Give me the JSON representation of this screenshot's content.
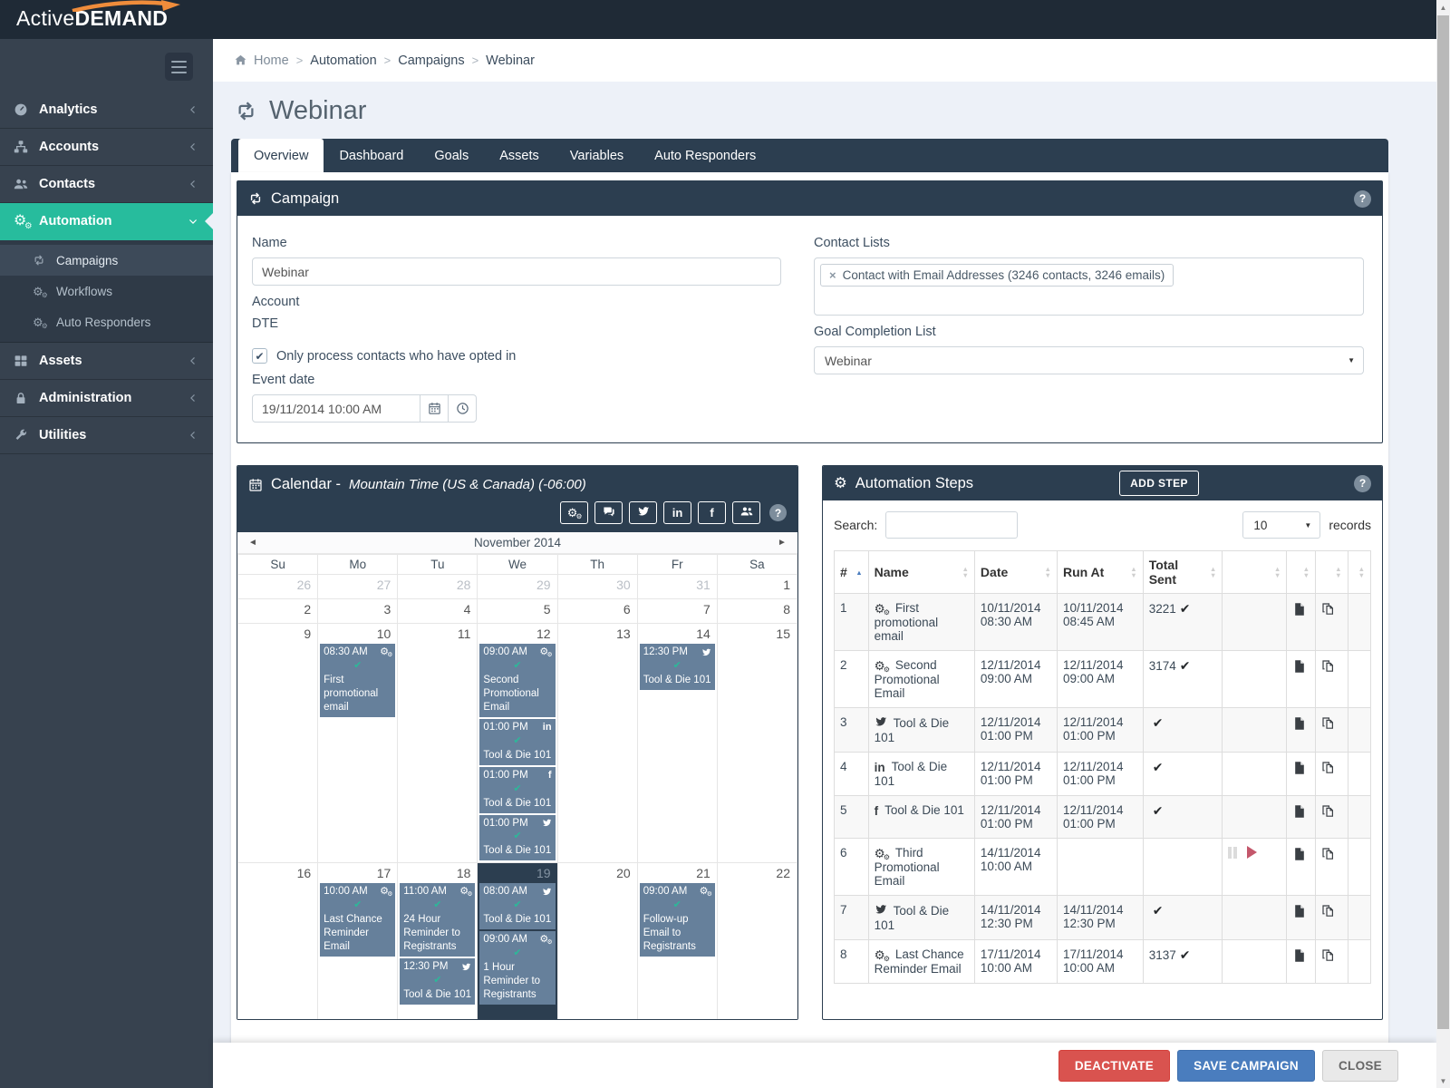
{
  "navbar": {
    "logo_active": "Active",
    "logo_demand": "DEMAND"
  },
  "colors": {
    "accent_green": "#27bc9d",
    "navy": "#2c3e50",
    "event_slate": "#66809b",
    "check_teal": "#2cb899",
    "danger": "#d9534f",
    "primary": "#4a7dbe"
  },
  "sidebar": {
    "items": [
      {
        "label": "Analytics",
        "icon": "gauge",
        "chevron": "left"
      },
      {
        "label": "Accounts",
        "icon": "sitemap",
        "chevron": "left"
      },
      {
        "label": "Contacts",
        "icon": "users",
        "chevron": "left"
      },
      {
        "label": "Automation",
        "icon": "gears",
        "chevron": "down",
        "active": true,
        "submenu": [
          {
            "label": "Campaigns",
            "icon": "retweet",
            "active": true
          },
          {
            "label": "Workflows",
            "icon": "gears"
          },
          {
            "label": "Auto Responders",
            "icon": "gears"
          }
        ]
      },
      {
        "label": "Assets",
        "icon": "grid",
        "chevron": "left"
      },
      {
        "label": "Administration",
        "icon": "lock",
        "chevron": "left"
      },
      {
        "label": "Utilities",
        "icon": "wrench",
        "chevron": "left"
      }
    ]
  },
  "breadcrumb": {
    "items": [
      "Home",
      "Automation",
      "Campaigns",
      "Webinar"
    ]
  },
  "page": {
    "title": "Webinar"
  },
  "tabs": [
    {
      "label": "Overview",
      "active": true
    },
    {
      "label": "Dashboard"
    },
    {
      "label": "Goals"
    },
    {
      "label": "Assets"
    },
    {
      "label": "Variables"
    },
    {
      "label": "Auto Responders"
    }
  ],
  "campaign": {
    "panel_title": "Campaign",
    "name_label": "Name",
    "name_value": "Webinar",
    "account_label": "Account",
    "account_value": "DTE",
    "optin_label": "Only process contacts who have opted in",
    "optin_checked": true,
    "event_date_label": "Event date",
    "event_date_value": "19/11/2014 10:00 AM",
    "contact_lists_label": "Contact Lists",
    "contact_list_tag": "Contact with Email Addresses (3246 contacts, 3246 emails)",
    "goal_list_label": "Goal Completion List",
    "goal_list_value": "Webinar"
  },
  "calendar": {
    "title": "Calendar -",
    "timezone": "Mountain Time (US & Canada) (-06:00)",
    "toolbar_icons": [
      "gears",
      "comments",
      "twitter",
      "linkedin",
      "facebook",
      "users"
    ],
    "month_label": "November 2014",
    "day_headers": [
      "Su",
      "Mo",
      "Tu",
      "We",
      "Th",
      "Fr",
      "Sa"
    ],
    "weeks": [
      [
        {
          "day": 26,
          "muted": true
        },
        {
          "day": 27,
          "muted": true
        },
        {
          "day": 28,
          "muted": true
        },
        {
          "day": 29,
          "muted": true
        },
        {
          "day": 30,
          "muted": true
        },
        {
          "day": 31,
          "muted": true
        },
        {
          "day": 1
        }
      ],
      [
        {
          "day": 2
        },
        {
          "day": 3
        },
        {
          "day": 4
        },
        {
          "day": 5
        },
        {
          "day": 6
        },
        {
          "day": 7
        },
        {
          "day": 8
        }
      ],
      [
        {
          "day": 9
        },
        {
          "day": 10,
          "events": [
            {
              "time": "08:30 AM",
              "icon": "gears",
              "checked": true,
              "title": "First promotional email"
            }
          ]
        },
        {
          "day": 11
        },
        {
          "day": 12,
          "events": [
            {
              "time": "09:00 AM",
              "icon": "gears",
              "checked": true,
              "title": "Second Promotional Email"
            },
            {
              "time": "01:00 PM",
              "icon": "linkedin",
              "checked": true,
              "title": "Tool & Die 101"
            },
            {
              "time": "01:00 PM",
              "icon": "facebook",
              "checked": true,
              "title": "Tool & Die 101"
            },
            {
              "time": "01:00 PM",
              "icon": "twitter",
              "checked": true,
              "title": "Tool & Die 101"
            }
          ]
        },
        {
          "day": 13
        },
        {
          "day": 14,
          "events": [
            {
              "time": "12:30 PM",
              "icon": "twitter",
              "checked": true,
              "title": "Tool & Die 101"
            }
          ]
        },
        {
          "day": 15
        }
      ],
      [
        {
          "day": 16
        },
        {
          "day": 17,
          "events": [
            {
              "time": "10:00 AM",
              "icon": "gears",
              "checked": true,
              "title": "Last Chance Reminder Email"
            }
          ]
        },
        {
          "day": 18,
          "events": [
            {
              "time": "11:00 AM",
              "icon": "gears",
              "checked": true,
              "title": "24 Hour Reminder to Registrants"
            },
            {
              "time": "12:30 PM",
              "icon": "twitter",
              "checked": true,
              "title": "Tool & Die 101"
            }
          ]
        },
        {
          "day": 19,
          "today": true,
          "events": [
            {
              "time": "08:00 AM",
              "icon": "twitter",
              "checked": true,
              "title": "Tool & Die 101"
            },
            {
              "time": "09:00 AM",
              "icon": "gears",
              "checked": true,
              "title": "1 Hour Reminder to Registrants"
            }
          ]
        },
        {
          "day": 20
        },
        {
          "day": 21,
          "events": [
            {
              "time": "09:00 AM",
              "icon": "gears",
              "checked": true,
              "title": "Follow-up Email to Registrants"
            }
          ]
        },
        {
          "day": 22
        }
      ]
    ]
  },
  "steps": {
    "panel_title": "Automation Steps",
    "add_button": "ADD STEP",
    "search_label": "Search:",
    "page_size": "10",
    "records_label": "records",
    "columns": [
      {
        "label": "#",
        "sort": "asc"
      },
      {
        "label": "Name",
        "sort": "both"
      },
      {
        "label": "Date",
        "sort": "both"
      },
      {
        "label": "Run At",
        "sort": "both"
      },
      {
        "label": "Total Sent",
        "sort": "both"
      },
      {
        "label": "",
        "sort": "both"
      },
      {
        "label": "",
        "sort": "both"
      },
      {
        "label": "",
        "sort": "both"
      },
      {
        "label": "",
        "sort": "both"
      }
    ],
    "rows": [
      {
        "num": "1",
        "icon": "gears",
        "name": "First promotional email",
        "date": "10/11/2014 08:30 AM",
        "run_at": "10/11/2014 08:45 AM",
        "total_sent": "3221",
        "sent_check": true,
        "controls": []
      },
      {
        "num": "2",
        "icon": "gears",
        "name": "Second Promotional Email",
        "date": "12/11/2014 09:00 AM",
        "run_at": "12/11/2014 09:00 AM",
        "total_sent": "3174",
        "sent_check": true,
        "controls": []
      },
      {
        "num": "3",
        "icon": "twitter",
        "name": "Tool & Die 101",
        "date": "12/11/2014 01:00 PM",
        "run_at": "12/11/2014 01:00 PM",
        "total_sent": "",
        "sent_check": true,
        "controls": []
      },
      {
        "num": "4",
        "icon": "linkedin",
        "name": "Tool & Die 101",
        "date": "12/11/2014 01:00 PM",
        "run_at": "12/11/2014 01:00 PM",
        "total_sent": "",
        "sent_check": true,
        "controls": []
      },
      {
        "num": "5",
        "icon": "facebook",
        "name": "Tool & Die 101",
        "date": "12/11/2014 01:00 PM",
        "run_at": "12/11/2014 01:00 PM",
        "total_sent": "",
        "sent_check": true,
        "controls": []
      },
      {
        "num": "6",
        "icon": "gears",
        "name": "Third Promotional Email",
        "date": "14/11/2014 10:00 AM",
        "run_at": "",
        "total_sent": "",
        "sent_check": false,
        "controls": [
          "pause",
          "play"
        ]
      },
      {
        "num": "7",
        "icon": "twitter",
        "name": "Tool & Die 101",
        "date": "14/11/2014 12:30 PM",
        "run_at": "14/11/2014 12:30 PM",
        "total_sent": "",
        "sent_check": true,
        "controls": []
      },
      {
        "num": "8",
        "icon": "gears",
        "name": "Last Chance Reminder Email",
        "date": "17/11/2014 10:00 AM",
        "run_at": "17/11/2014 10:00 AM",
        "total_sent": "3137",
        "sent_check": true,
        "controls": []
      }
    ]
  },
  "footer": {
    "buttons": [
      {
        "label": "DEACTIVATE",
        "style": "danger"
      },
      {
        "label": "SAVE CAMPAIGN",
        "style": "primary"
      },
      {
        "label": "CLOSE",
        "style": "default"
      }
    ]
  }
}
